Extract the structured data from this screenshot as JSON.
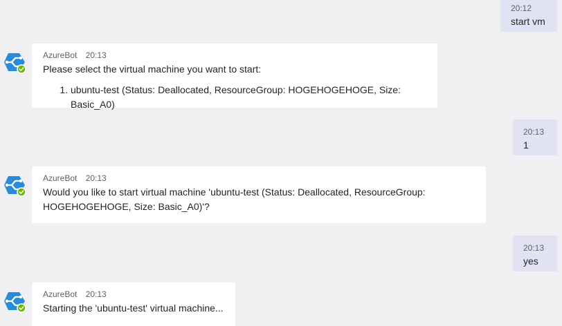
{
  "theme": {
    "background": "#F0F0F3",
    "outgoing_bubble": "#E2E2F5",
    "incoming_bubble": "#FFFFFF",
    "bot_icon_blue": "#2A8BD8",
    "status_green": "#6BB700"
  },
  "messages": [
    {
      "direction": "out",
      "time": "20:12",
      "text": "start vm"
    },
    {
      "direction": "in",
      "sender": "AzureBot",
      "avatar_icon": "azure-bot-icon",
      "time": "20:13",
      "text": "Please select the virtual machine you want to start:",
      "list": [
        "ubuntu-test (Status: Deallocated, ResourceGroup: HOGEHOGEHOGE, Size: Basic_A0)"
      ]
    },
    {
      "direction": "out",
      "time": "20:13",
      "text": "1"
    },
    {
      "direction": "in",
      "sender": "AzureBot",
      "avatar_icon": "azure-bot-icon",
      "time": "20:13",
      "text_line1": "Would you like to start virtual machine 'ubuntu-test (Status: Deallocated, ResourceGroup:",
      "text_line2": "HOGEHOGEHOGE, Size: Basic_A0)'?"
    },
    {
      "direction": "out",
      "time": "20:13",
      "text": "yes"
    },
    {
      "direction": "in",
      "sender": "AzureBot",
      "avatar_icon": "azure-bot-icon",
      "time": "20:13",
      "text": "Starting the 'ubuntu-test' virtual machine..."
    }
  ]
}
